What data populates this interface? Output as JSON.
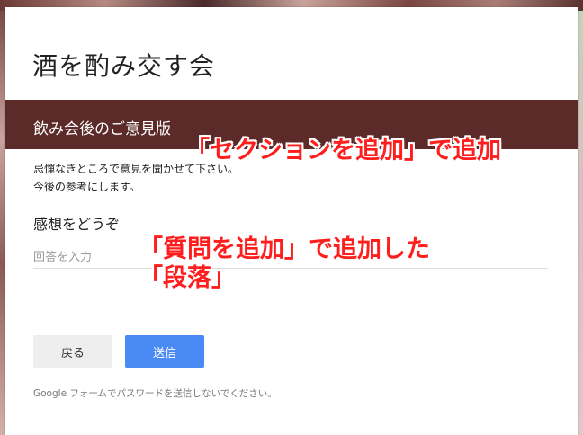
{
  "form": {
    "title": "酒を酌み交す会",
    "section_title": "飲み会後のご意見版",
    "description_lines": [
      "忌憚なきところで意見を聞かせて下さい。",
      "今後の参考にします。"
    ],
    "question": {
      "title": "感想をどうぞ",
      "placeholder": "回答を入力"
    },
    "buttons": {
      "back": "戻る",
      "submit": "送信"
    },
    "footer_note": "Google フォームでパスワードを送信しないでください。",
    "colors": {
      "section_bar": "#5b2a29",
      "submit_button": "#4a8af4",
      "annotation": "#ff1e1e"
    }
  },
  "annotations": {
    "section_added": "「セクションを追加」で追加",
    "question_added_line1": "「質問を追加」で追加した",
    "question_added_line2": "「段落」"
  }
}
